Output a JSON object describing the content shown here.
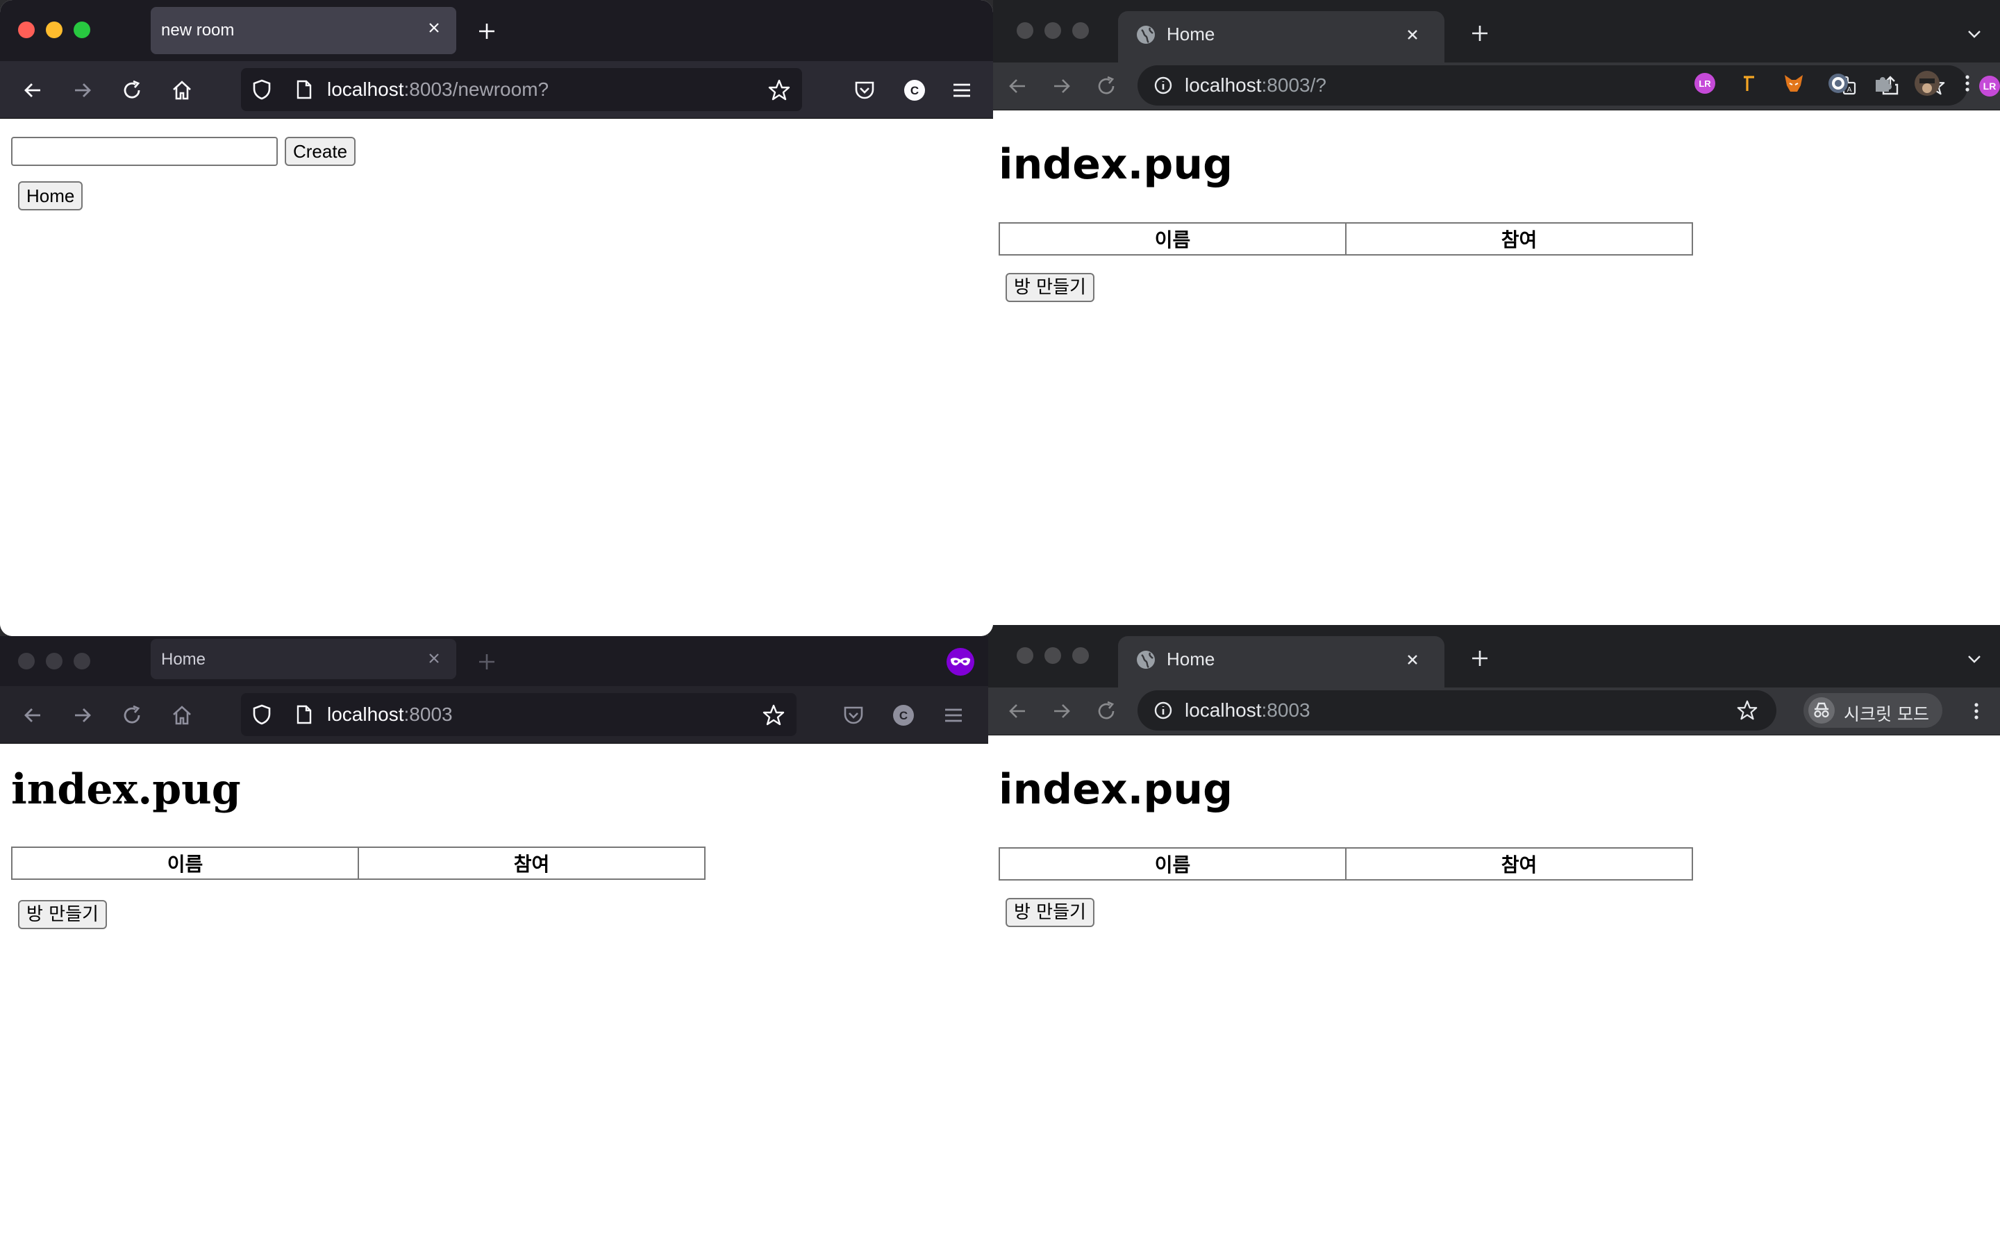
{
  "windows": {
    "top_left": {
      "browser": "firefox",
      "tab_title": "new room",
      "url_host": "localhost",
      "url_rest": ":8003/newroom?",
      "page": {
        "input_value": "",
        "create_button": "Create",
        "home_button": "Home"
      }
    },
    "top_right": {
      "browser": "chrome",
      "tab_title": "Home",
      "url_host": "localhost",
      "url_rest": ":8003/?",
      "page": {
        "heading": "index.pug",
        "columns": [
          "이름",
          "참여"
        ],
        "make_room_button": "방 만들기"
      }
    },
    "bottom_left": {
      "browser": "firefox-private",
      "tab_title": "Home",
      "url_host": "localhost",
      "url_rest": ":8003",
      "page": {
        "heading": "index.pug",
        "columns": [
          "이름",
          "참여"
        ],
        "make_room_button": "방 만들기"
      }
    },
    "bottom_right": {
      "browser": "chrome-incognito",
      "tab_title": "Home",
      "url_host": "localhost",
      "url_rest": ":8003",
      "incognito_label": "시크릿 모드",
      "page": {
        "heading": "index.pug",
        "columns": [
          "이름",
          "참여"
        ],
        "make_room_button": "방 만들기"
      }
    }
  },
  "icons": {
    "firefox_toolbar": [
      "back-icon",
      "forward-icon",
      "reload-icon",
      "home-icon",
      "shield-icon",
      "page-icon",
      "star-icon",
      "pocket-icon",
      "account-icon",
      "menu-icon"
    ],
    "chrome_toolbar": [
      "back-icon",
      "forward-icon",
      "reload-icon",
      "info-icon",
      "translate-icon",
      "share-icon",
      "star-icon",
      "extensions-icon",
      "kebab-menu-icon"
    ],
    "private_mask": "private-browsing-mask-icon"
  },
  "colors": {
    "firefox_tabbar": "#1c1b22",
    "firefox_navbar": "#2b2a33",
    "chrome_tabbar": "#202124",
    "chrome_navbar": "#35363a",
    "private_mask": "#8000d7",
    "traffic_close": "#ff5f57",
    "traffic_minimize": "#febc2e",
    "traffic_maximize": "#28c840"
  }
}
